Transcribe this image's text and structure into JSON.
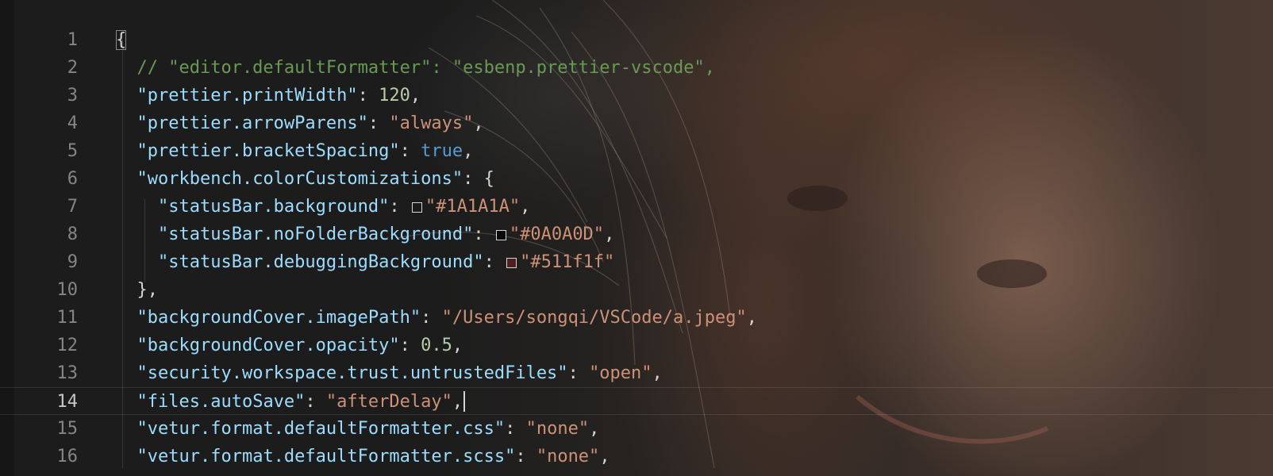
{
  "editor": {
    "active_line": 14,
    "lines": [
      {
        "n": "1",
        "tokens": [
          {
            "t": "{",
            "c": "punc-brace"
          }
        ]
      },
      {
        "n": "2",
        "tokens": [
          {
            "t": "  // \"editor.defaultFormatter\": \"esbenp.prettier-vscode\",",
            "c": "cmt"
          }
        ]
      },
      {
        "n": "3",
        "tokens": [
          {
            "t": "  ",
            "c": "punc"
          },
          {
            "t": "\"prettier.printWidth\"",
            "c": "key"
          },
          {
            "t": ": ",
            "c": "punc"
          },
          {
            "t": "120",
            "c": "num"
          },
          {
            "t": ",",
            "c": "punc"
          }
        ]
      },
      {
        "n": "4",
        "tokens": [
          {
            "t": "  ",
            "c": "punc"
          },
          {
            "t": "\"prettier.arrowParens\"",
            "c": "key"
          },
          {
            "t": ": ",
            "c": "punc"
          },
          {
            "t": "\"always\"",
            "c": "str"
          },
          {
            "t": ",",
            "c": "punc"
          }
        ]
      },
      {
        "n": "5",
        "tokens": [
          {
            "t": "  ",
            "c": "punc"
          },
          {
            "t": "\"prettier.bracketSpacing\"",
            "c": "key"
          },
          {
            "t": ": ",
            "c": "punc"
          },
          {
            "t": "true",
            "c": "bool"
          },
          {
            "t": ",",
            "c": "punc"
          }
        ]
      },
      {
        "n": "6",
        "tokens": [
          {
            "t": "  ",
            "c": "punc"
          },
          {
            "t": "\"workbench.colorCustomizations\"",
            "c": "key"
          },
          {
            "t": ": {",
            "c": "punc"
          }
        ]
      },
      {
        "n": "7",
        "tokens": [
          {
            "t": "    ",
            "c": "punc"
          },
          {
            "t": "\"statusBar.background\"",
            "c": "key"
          },
          {
            "t": ": ",
            "c": "punc"
          },
          {
            "t": "",
            "c": "swatch",
            "color": "#1A1A1A"
          },
          {
            "t": "\"#1A1A1A\"",
            "c": "str"
          },
          {
            "t": ",",
            "c": "punc"
          }
        ]
      },
      {
        "n": "8",
        "tokens": [
          {
            "t": "    ",
            "c": "punc"
          },
          {
            "t": "\"statusBar.noFolderBackground\"",
            "c": "key"
          },
          {
            "t": ": ",
            "c": "punc"
          },
          {
            "t": "",
            "c": "swatch",
            "color": "#0A0A0D"
          },
          {
            "t": "\"#0A0A0D\"",
            "c": "str"
          },
          {
            "t": ",",
            "c": "punc"
          }
        ]
      },
      {
        "n": "9",
        "tokens": [
          {
            "t": "    ",
            "c": "punc"
          },
          {
            "t": "\"statusBar.debuggingBackground\"",
            "c": "key"
          },
          {
            "t": ": ",
            "c": "punc"
          },
          {
            "t": "",
            "c": "swatch",
            "color": "#511f1f"
          },
          {
            "t": "\"#511f1f\"",
            "c": "str"
          }
        ]
      },
      {
        "n": "10",
        "tokens": [
          {
            "t": "  },",
            "c": "punc"
          }
        ]
      },
      {
        "n": "11",
        "tokens": [
          {
            "t": "  ",
            "c": "punc"
          },
          {
            "t": "\"backgroundCover.imagePath\"",
            "c": "key"
          },
          {
            "t": ": ",
            "c": "punc"
          },
          {
            "t": "\"/Users/songqi/VSCode/a.jpeg\"",
            "c": "str"
          },
          {
            "t": ",",
            "c": "punc"
          }
        ]
      },
      {
        "n": "12",
        "tokens": [
          {
            "t": "  ",
            "c": "punc"
          },
          {
            "t": "\"backgroundCover.opacity\"",
            "c": "key"
          },
          {
            "t": ": ",
            "c": "punc"
          },
          {
            "t": "0.5",
            "c": "num"
          },
          {
            "t": ",",
            "c": "punc"
          }
        ]
      },
      {
        "n": "13",
        "tokens": [
          {
            "t": "  ",
            "c": "punc"
          },
          {
            "t": "\"security.workspace.trust.untrustedFiles\"",
            "c": "key"
          },
          {
            "t": ": ",
            "c": "punc"
          },
          {
            "t": "\"open\"",
            "c": "str"
          },
          {
            "t": ",",
            "c": "punc"
          }
        ]
      },
      {
        "n": "14",
        "tokens": [
          {
            "t": "  ",
            "c": "punc"
          },
          {
            "t": "\"files.autoSave\"",
            "c": "key"
          },
          {
            "t": ": ",
            "c": "punc"
          },
          {
            "t": "\"afterDelay\"",
            "c": "str"
          },
          {
            "t": ",",
            "c": "punc"
          },
          {
            "t": "",
            "c": "cursor"
          }
        ]
      },
      {
        "n": "15",
        "tokens": [
          {
            "t": "  ",
            "c": "punc"
          },
          {
            "t": "\"vetur.format.defaultFormatter.css\"",
            "c": "key"
          },
          {
            "t": ": ",
            "c": "punc"
          },
          {
            "t": "\"none\"",
            "c": "str"
          },
          {
            "t": ",",
            "c": "punc"
          }
        ]
      },
      {
        "n": "16",
        "tokens": [
          {
            "t": "  ",
            "c": "punc"
          },
          {
            "t": "\"vetur.format.defaultFormatter.scss\"",
            "c": "key"
          },
          {
            "t": ": ",
            "c": "punc"
          },
          {
            "t": "\"none\"",
            "c": "str"
          },
          {
            "t": ",",
            "c": "punc"
          }
        ]
      }
    ]
  },
  "colors": {
    "key": "#9cdcfe",
    "string": "#ce9178",
    "number": "#b5cea8",
    "boolean": "#569cd6",
    "comment": "#6a9955",
    "punctuation": "#d4d4d4",
    "line_number": "#858585"
  }
}
